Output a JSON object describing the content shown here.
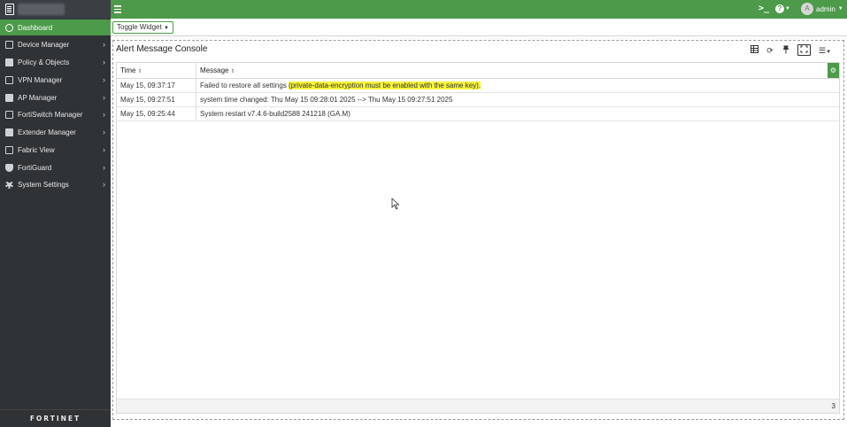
{
  "topbar": {
    "user_initial": "A",
    "user_name": "admin",
    "cli_icon": ">_"
  },
  "sidebar": {
    "items": [
      {
        "label": "Dashboard",
        "icon": "dashboard-icon",
        "active": true
      },
      {
        "label": "Device Manager",
        "icon": "device-icon"
      },
      {
        "label": "Policy & Objects",
        "icon": "policy-icon"
      },
      {
        "label": "VPN Manager",
        "icon": "vpn-icon"
      },
      {
        "label": "AP Manager",
        "icon": "ap-icon"
      },
      {
        "label": "FortiSwitch Manager",
        "icon": "switch-icon"
      },
      {
        "label": "Extender Manager",
        "icon": "extender-icon"
      },
      {
        "label": "Fabric View",
        "icon": "fabric-icon"
      },
      {
        "label": "FortiGuard",
        "icon": "shield-icon"
      },
      {
        "label": "System Settings",
        "icon": "gear-icon"
      }
    ],
    "brand": "FORTINET"
  },
  "toolbar": {
    "toggle_widget_label": "Toggle Widget"
  },
  "widget": {
    "title": "Alert Message Console",
    "columns": [
      "Time",
      "Message"
    ],
    "rows": [
      {
        "time": "May 15, 09:37:17",
        "message_prefix": "Failed to restore all settings ",
        "message_highlight": "(private-data-encryption must be enabled with the same key)."
      },
      {
        "time": "May 15, 09:27:51",
        "message_prefix": "system time changed: Thu May 15 09:28:01 2025 --> Thu May 15 09:27:51 2025",
        "message_highlight": ""
      },
      {
        "time": "May 15, 09:25:44",
        "message_prefix": "System restart v7.4.6-build2588 241218 (GA.M)",
        "message_highlight": ""
      }
    ],
    "total_count": "3"
  },
  "colors": {
    "brand_green": "#4c9a4a",
    "sidebar_bg": "#2f3336",
    "highlight": "#f7f53a"
  }
}
